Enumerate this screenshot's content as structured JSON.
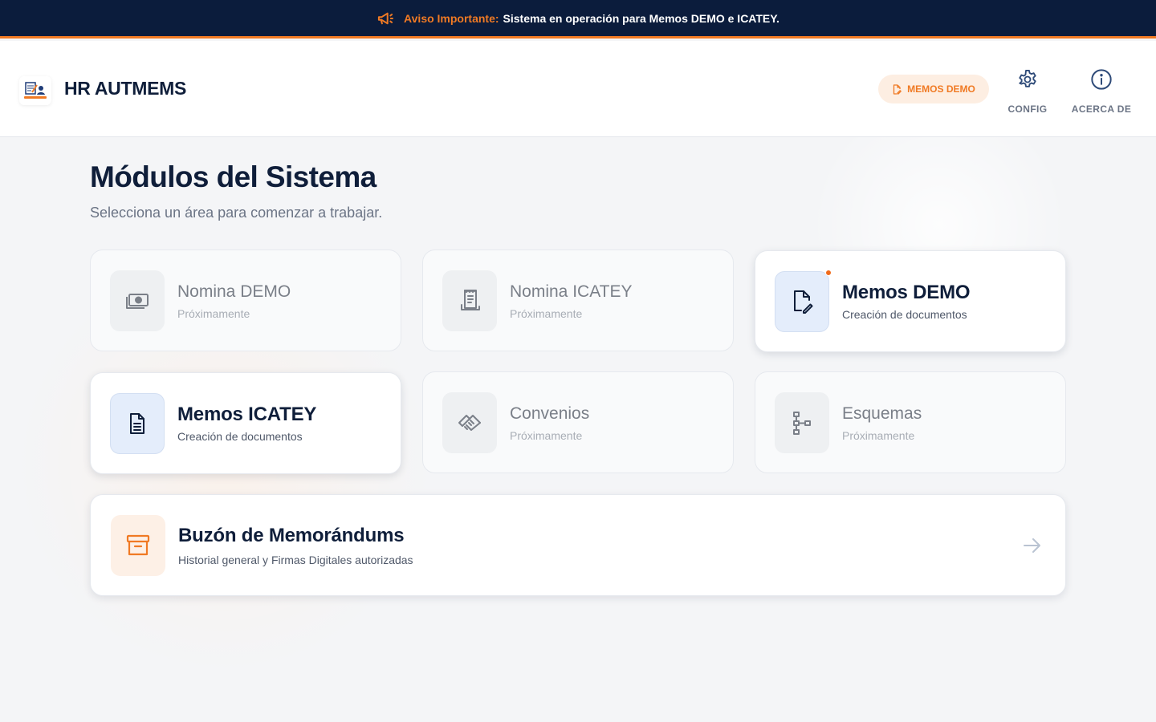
{
  "banner": {
    "label": "Aviso Importante:",
    "message": "Sistema en operación para Memos DEMO e ICATEY.",
    "icon": "megaphone-icon"
  },
  "header": {
    "app_title": "HR AUTMEMS",
    "active_module_pill": "MEMOS DEMO",
    "config_label": "CONFIG",
    "about_label": "ACERCA DE"
  },
  "main": {
    "title": "Módulos del Sistema",
    "subtitle": "Selecciona un área para comenzar a trabajar.",
    "modules": [
      {
        "title": "Nomina DEMO",
        "subtitle": "Próximamente",
        "icon": "money-icon",
        "enabled": false
      },
      {
        "title": "Nomina ICATEY",
        "subtitle": "Próximamente",
        "icon": "receipt-icon",
        "enabled": false
      },
      {
        "title": "Memos DEMO",
        "subtitle": "Creación de documentos",
        "icon": "file-edit-icon",
        "enabled": true,
        "notification": true
      },
      {
        "title": "Memos ICATEY",
        "subtitle": "Creación de documentos",
        "icon": "document-icon",
        "enabled": true
      },
      {
        "title": "Convenios",
        "subtitle": "Próximamente",
        "icon": "handshake-icon",
        "enabled": false
      },
      {
        "title": "Esquemas",
        "subtitle": "Próximamente",
        "icon": "hierarchy-icon",
        "enabled": false
      }
    ],
    "mailbox": {
      "title": "Buzón de Memorándums",
      "subtitle": "Historial general y Firmas Digitales autorizadas",
      "icon": "archive-icon"
    }
  },
  "colors": {
    "navy": "#0b1c3c",
    "accent_orange": "#f07a24",
    "pill_bg": "#fdeee2",
    "icon_blue_bg": "#e4edfb",
    "muted_text": "#6b7485"
  }
}
